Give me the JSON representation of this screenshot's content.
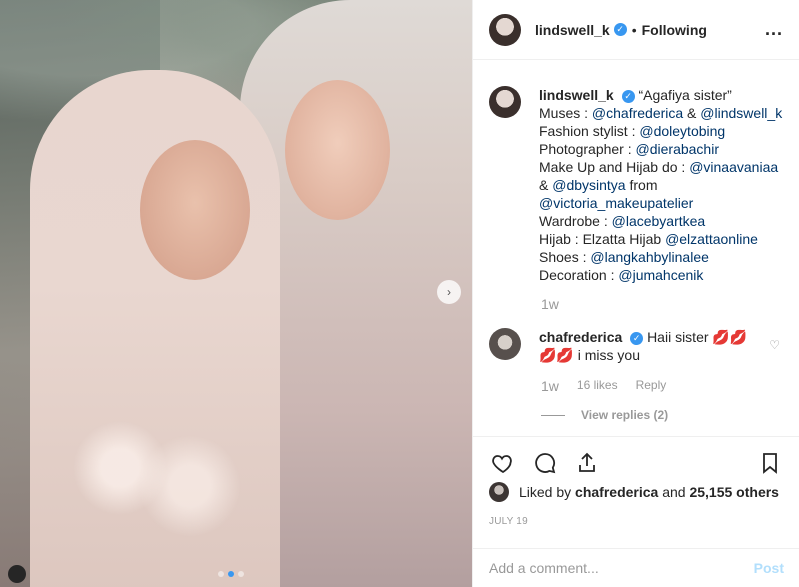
{
  "post": {
    "dots": [
      false,
      true,
      false
    ],
    "carousel_next_glyph": "›"
  },
  "header": {
    "username": "lindswell_k",
    "bullet": "•",
    "following": "Following",
    "more": "..."
  },
  "caption": {
    "username": "lindswell_k",
    "lines": [
      "“Agafiya sister”",
      "Muses : @chafrederica & @lindswell_k",
      "Fashion stylist : @doleytobing",
      "Photographer : @dierabachir",
      "Make Up and Hijab do : @vinaavaniaa",
      "& @dbysintya from",
      "@victoria_makeupatelier",
      "Wardrobe : @lacebyartkea",
      "Hijab : Elzatta Hijab @elzattaonline",
      "Shoes : @langkahbylinalee",
      "Decoration : @jumahcenik"
    ],
    "time": "1w"
  },
  "comment": {
    "username": "chafrederica",
    "text_start": "Haii sister",
    "emoji_kiss": "💋💋",
    "text_end": "i miss you",
    "time": "1w",
    "likes": "16 likes",
    "reply": "Reply",
    "view_replies": "View replies (2)"
  },
  "likes": {
    "prefix": "Liked by",
    "user": "chafrederica",
    "middle": "and",
    "count": "25,155 others"
  },
  "date": "JULY 19",
  "add_comment": {
    "placeholder": "Add a comment...",
    "post": "Post"
  },
  "colors": {
    "link": "#003569",
    "verified": "#3897f0",
    "muted": "#999999",
    "post_disabled": "#b2dffc"
  },
  "icons": [
    "heart-icon",
    "comment-icon",
    "share-icon",
    "bookmark-icon",
    "verified-icon",
    "more-icon",
    "carousel-next-icon",
    "small-heart-icon"
  ]
}
